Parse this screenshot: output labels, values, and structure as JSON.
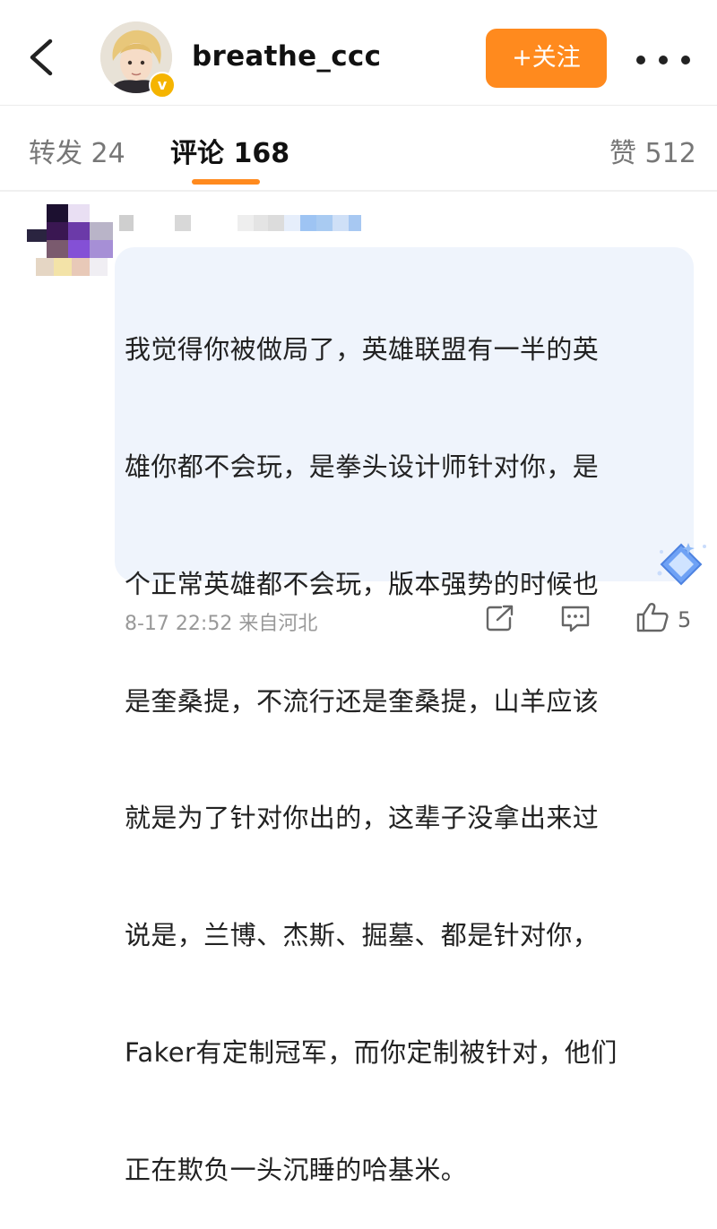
{
  "header": {
    "username": "breathe_ccc",
    "follow_label": "+关注",
    "back_icon": "chevron-left-icon",
    "more_icon": "more-dots-icon",
    "verified_icon": "verified-v-badge"
  },
  "tabs": {
    "repost": "转发 24",
    "comments": "评论 168",
    "likes": "赞 512"
  },
  "comment": {
    "lines": [
      "我觉得你被做局了，英雄联盟有一半的英",
      "雄你都不会玩，是拳头设计师针对你，是",
      "个正常英雄都不会玩，版本强势的时候也",
      "是奎桑提，不流行还是奎桑提，山羊应该",
      "就是为了针对你出的，这辈子没拿出来过",
      "说是，兰博、杰斯、掘墓、都是针对你，",
      "Faker有定制冠军，而你定制被针对，他们",
      "正在欺负一头沉睡的哈基米。"
    ],
    "time_location": "8-17 22:52 来自河北",
    "like_count": "5",
    "accent_color": "#ff8a1e",
    "bubble_color": "#eff4fc"
  }
}
